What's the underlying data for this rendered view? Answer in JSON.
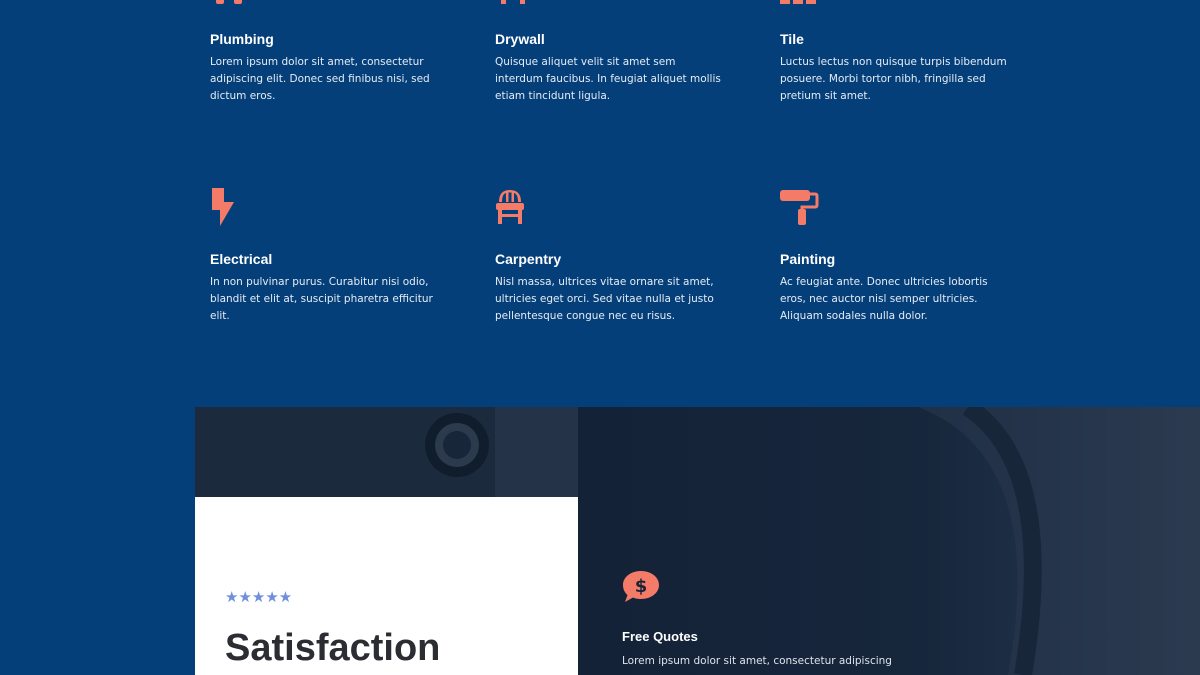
{
  "services": [
    {
      "title": "Plumbing",
      "text": "Lorem ipsum dolor sit amet, consectetur adipiscing elit. Donec sed finibus nisi, sed dictum eros.",
      "icon": "faucet-icon"
    },
    {
      "title": "Drywall",
      "text": "Quisque aliquet velit sit amet sem interdum faucibus. In feugiat aliquet mollis etiam tincidunt ligula.",
      "icon": "drywall-icon"
    },
    {
      "title": "Tile",
      "text": "Luctus lectus non quisque turpis bibendum posuere. Morbi tortor nibh, fringilla sed pretium sit amet.",
      "icon": "tile-icon"
    },
    {
      "title": "Electrical",
      "text": "In non pulvinar purus. Curabitur nisi odio, blandit et elit at, suscipit pharetra efficitur elit.",
      "icon": "lightning-bolt-icon"
    },
    {
      "title": "Carpentry",
      "text": "Nisl massa, ultrices vitae ornare sit amet, ultricies eget orci. Sed vitae nulla et justo pellentesque congue nec eu risus.",
      "icon": "chair-icon"
    },
    {
      "title": "Painting",
      "text": "Ac feugiat ante. Donec ultricies lobortis eros, nec auctor nisl semper ultricies. Aliquam sodales nulla dolor.",
      "icon": "paint-roller-icon"
    }
  ],
  "testimonial": {
    "stars": "★★★★★",
    "heading": "Satisfaction"
  },
  "feature": {
    "title": "Free Quotes",
    "text": "Lorem ipsum dolor sit amet, consectetur adipiscing",
    "icon": "dollar-speech-bubble-icon"
  },
  "colors": {
    "background": "#053f7a",
    "accent": "#f47b67",
    "star": "#6f8fdc"
  }
}
